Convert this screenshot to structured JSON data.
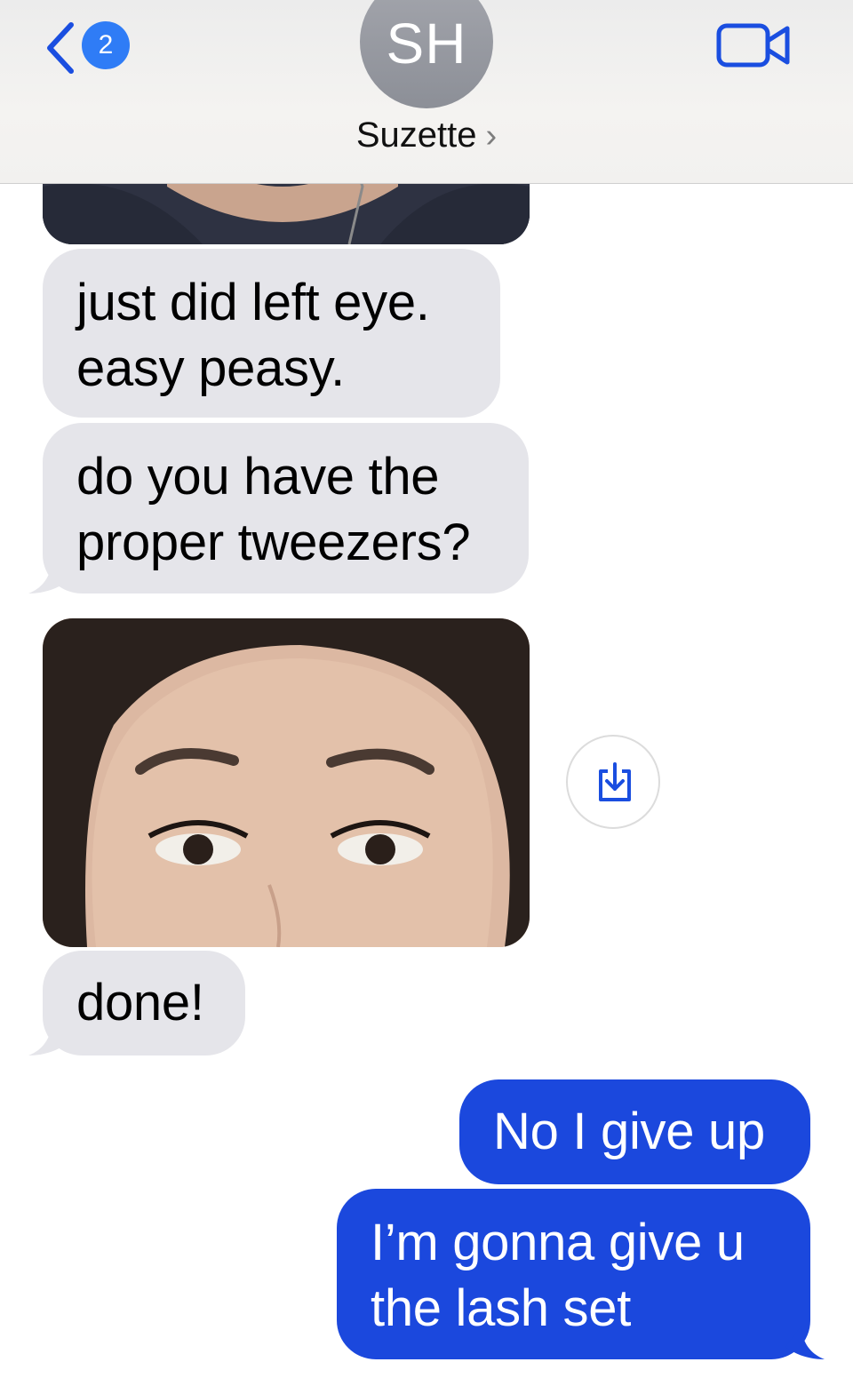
{
  "header": {
    "back_badge": "2",
    "avatar_initials": "SH",
    "contact_name": "Suzette",
    "chevron": "›"
  },
  "icons": {
    "back": "chevron-left-icon",
    "video": "video-camera-icon",
    "save": "download-icon"
  },
  "messages": {
    "m1": [
      "just did left eye.",
      "easy peasy."
    ],
    "m2": [
      "do you have the",
      "proper tweezers?"
    ],
    "m3": "done!",
    "m4": "No I give up",
    "m5": [
      "I’m gonna give u",
      "the lash set"
    ]
  },
  "colors": {
    "accent": "#1b48dd",
    "badge": "#2f7cf6",
    "incoming_bubble": "#e5e5ea"
  }
}
